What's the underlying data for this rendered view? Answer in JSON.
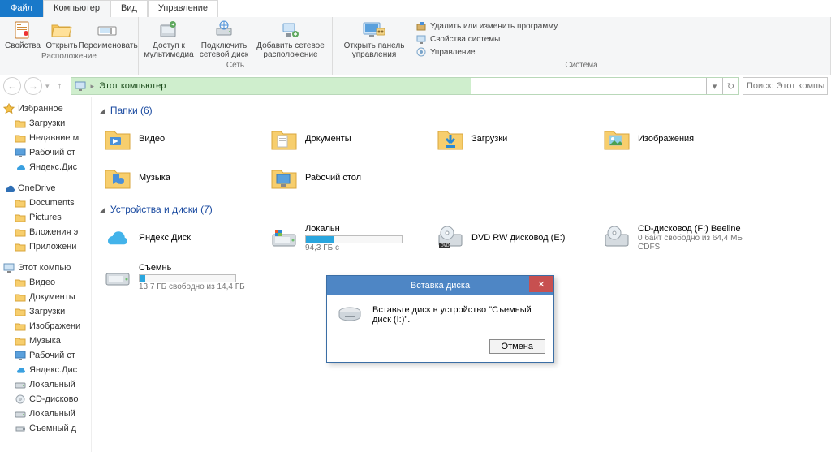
{
  "tabs": {
    "file": "Файл",
    "computer": "Компьютер",
    "view": "Вид",
    "manage": "Управление"
  },
  "ribbon": {
    "group1": {
      "props": "Свойства",
      "open": "Открыть",
      "rename": "Переименовать",
      "caption": "Расположение"
    },
    "group2": {
      "media": "Доступ к мультимедиа",
      "netdrive": "Подключить сетевой диск",
      "addnet": "Добавить сетевое расположение",
      "caption": "Сеть"
    },
    "group3": {
      "panel": "Открыть панель управления",
      "uninstall": "Удалить или изменить программу",
      "sysprops": "Свойства системы",
      "manage": "Управление",
      "caption": "Система"
    }
  },
  "address": {
    "text": "Этот компьютер"
  },
  "search": {
    "placeholder": "Поиск: Этот компьют"
  },
  "sidebar": {
    "favorites": {
      "title": "Избранное",
      "items": [
        "Загрузки",
        "Недавние м",
        "Рабочий ст",
        "Яндекс.Дис"
      ]
    },
    "onedrive": {
      "title": "OneDrive",
      "items": [
        "Documents",
        "Pictures",
        "Вложения э",
        "Приложени"
      ]
    },
    "computer": {
      "title": "Этот компью",
      "items": [
        "Видео",
        "Документы",
        "Загрузки",
        "Изображени",
        "Музыка",
        "Рабочий ст",
        "Яндекс.Дис",
        "Локальный",
        "CD-дисково",
        "Локальный",
        "Съемный д"
      ]
    }
  },
  "main": {
    "folders": {
      "title": "Папки (6)",
      "items": [
        "Видео",
        "Документы",
        "Загрузки",
        "Изображения",
        "Музыка",
        "Рабочий стол"
      ]
    },
    "drives": {
      "title": "Устройства и диски (7)",
      "items": [
        {
          "name": "Яндекс.Диск",
          "sub": "",
          "type": "cloud"
        },
        {
          "name": "Локальн",
          "sub": "94,3 ГБ с",
          "type": "hdd",
          "fill": 30
        },
        {
          "name": "DVD RW дисковод (E:)",
          "sub": "",
          "type": "dvd"
        },
        {
          "name": "CD-дисковод (F:) Beeline",
          "sub": "0 байт свободно из 64,4 МБ",
          "sub2": "CDFS",
          "type": "cd"
        },
        {
          "name": "Съемнь",
          "sub": "13,7 ГБ свободно из 14,4 ГБ",
          "type": "usb",
          "fill": 6
        }
      ]
    }
  },
  "dialog": {
    "title": "Вставка диска",
    "message": "Вставьте диск в устройство \"Съемный диск (I:)\".",
    "cancel": "Отмена"
  }
}
